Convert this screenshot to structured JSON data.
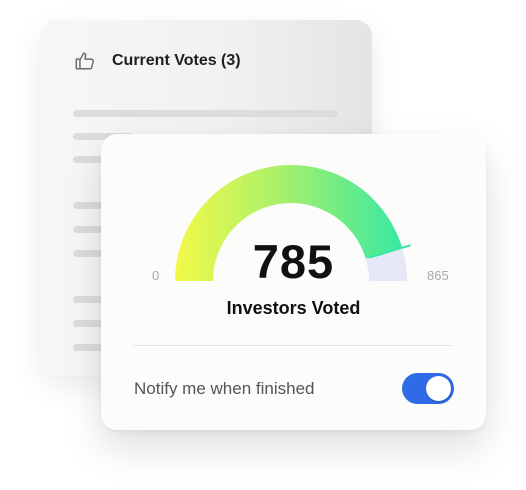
{
  "back_card": {
    "title": "Current Votes (3)",
    "icon": "thumbs-up-icon"
  },
  "gauge": {
    "min_label": "0",
    "max_label": "865",
    "value": 785,
    "value_label": "785",
    "min": 0,
    "max": 865,
    "caption": "Investors Voted",
    "colors": {
      "start": "#f3f94a",
      "mid": "#a8f06a",
      "end": "#35e8a4",
      "track": "#e6e8f8",
      "marker": "#35e8a4"
    }
  },
  "notify": {
    "label": "Notify me when finished",
    "enabled": true,
    "accent": "#2f6be6"
  }
}
